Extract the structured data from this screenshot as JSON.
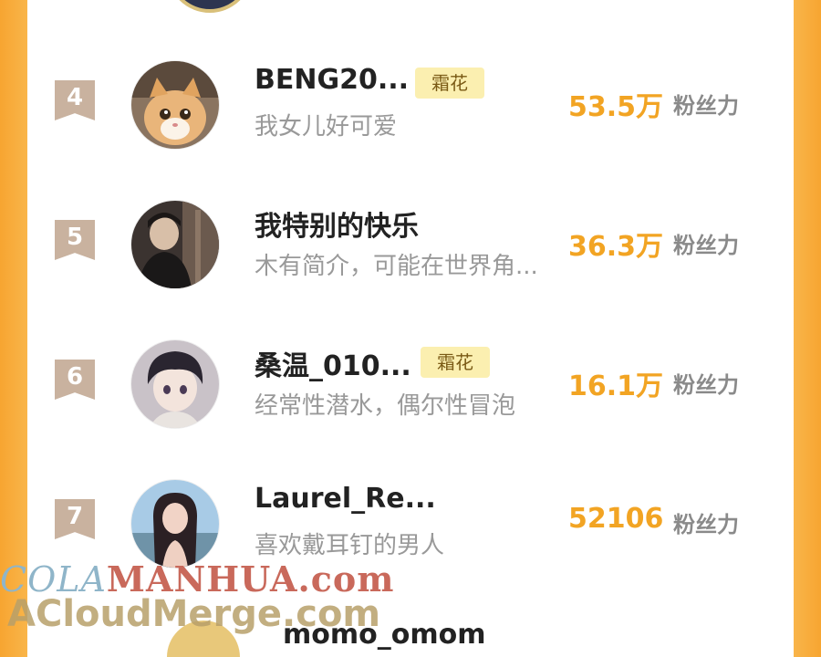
{
  "rows": [
    {
      "rank": "4",
      "name": "BENG20...",
      "badge": "霜花",
      "bio": "我女儿好可爱",
      "fans": "53.5万",
      "fans_label": "粉丝力",
      "avatar": "cat-avatar"
    },
    {
      "rank": "5",
      "name": "我特别的快乐",
      "badge": "",
      "bio": "木有简介，可能在世界角...",
      "fans": "36.3万",
      "fans_label": "粉丝力",
      "avatar": "person-avatar"
    },
    {
      "rank": "6",
      "name": "桑温_010...",
      "badge": "霜花",
      "bio": "经常性潜水，偶尔性冒泡",
      "fans": "16.1万",
      "fans_label": "粉丝力",
      "avatar": "anime-boy-avatar"
    },
    {
      "rank": "7",
      "name": "Laurel_Re...",
      "badge": "",
      "bio": "喜欢戴耳钉的男人",
      "fans": "52106",
      "fans_label": "粉丝力",
      "avatar": "girl-avatar"
    }
  ],
  "partial_next_name": "momo_omom",
  "watermark": {
    "line1_a": "COLA",
    "line1_b": "MANHUA.com",
    "line2": "ACloudMerge.com"
  },
  "colors": {
    "accent": "#f2a423",
    "rank_bg": "#c9b29f",
    "badge_bg": "#fbefb0",
    "frame": "#f9b54a"
  }
}
